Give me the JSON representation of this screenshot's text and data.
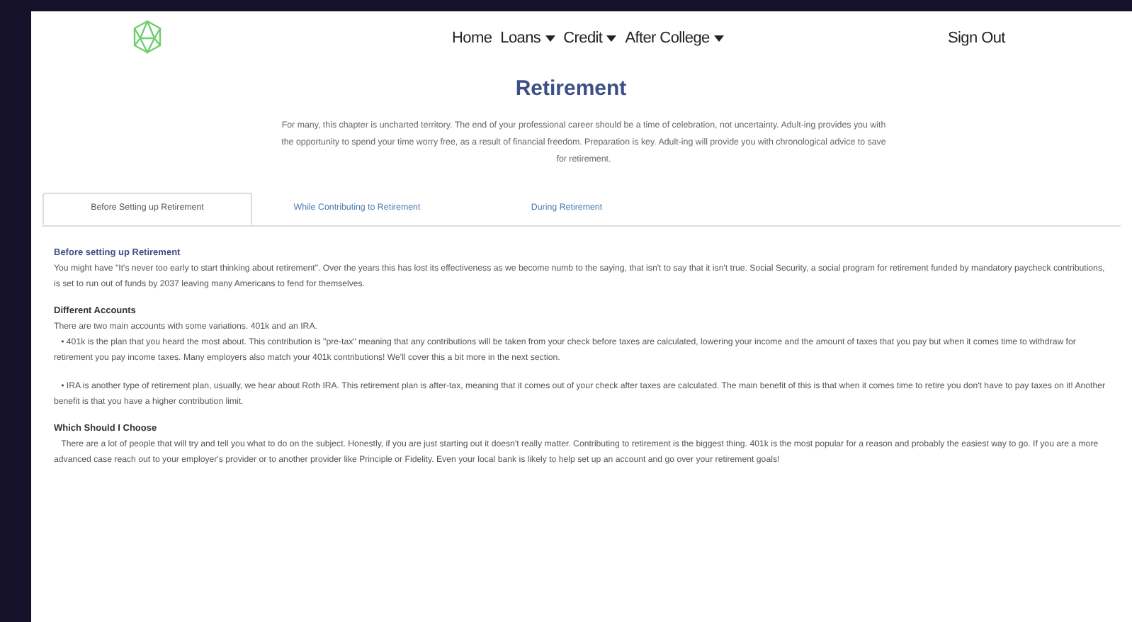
{
  "nav": {
    "items": [
      {
        "label": "Home",
        "kind": "link"
      },
      {
        "label": "Loans",
        "kind": "dropdown"
      },
      {
        "label": "Credit",
        "kind": "dropdown"
      },
      {
        "label": "After College",
        "kind": "dropdown"
      }
    ],
    "sign_out": "Sign Out"
  },
  "title": "Retirement",
  "intro": "For many, this chapter is uncharted territory. The end of your professional career should be a time of celebration, not uncertainty. Adult-ing provides you with the opportunity to spend your time worry free, as a result of financial freedom. Preparation is key. Adult-ing will provide you with chronological advice to save for retirement.",
  "tabs": [
    {
      "label": "Before Setting up Retirement",
      "selected": true
    },
    {
      "label": "While Contributing to Retirement",
      "selected": false
    },
    {
      "label": "During Retirement",
      "selected": false
    }
  ],
  "content_title": "Before setting up Retirement",
  "sections": [
    {
      "paragraphs": [
        "You might have \"It's never too early to start thinking about retirement\". Over the years this has lost its effectiveness as we become numb to the saying, that isn't to say that it isn't true. Social Security, a social program for retirement funded by mandatory paycheck contributions, is set to run out of funds by 2037 leaving many Americans to fend for themselves."
      ]
    },
    {
      "heading": "Different Accounts",
      "paragraphs": [
        "There are two main accounts with some variations. 401k and an IRA.",
        "   • 401k is the plan that you heard the most about. This contribution is \"pre-tax\" meaning that any contributions will be taken from your check before taxes are calculated, lowering your income and the amount of taxes that you pay but when it comes time to withdraw for retirement you pay income taxes. Many employers also match your 401k contributions! We'll cover this a bit more in the next section.",
        "   • IRA is another type of retirement plan, usually, we hear about Roth IRA. This retirement plan is after-tax, meaning that it comes out of your check after taxes are calculated. The main benefit of this is that when it comes time to retire you don't have to pay taxes on it! Another benefit is that you have a higher contribution limit."
      ]
    },
    {
      "heading": "Which Should I Choose",
      "paragraphs": [
        "   There are a lot of people that will try and tell you what to do on the subject. Honestly, if you are just starting out it doesn't really matter. Contributing to retirement is the biggest thing. 401k is the most popular for a reason and probably the easiest way to go. If you are a more advanced case reach out to your employer's provider or to another provider like Principle or Fidelity. Even your local bank is likely to help set up an account and go over your retirement goals!"
      ]
    }
  ]
}
